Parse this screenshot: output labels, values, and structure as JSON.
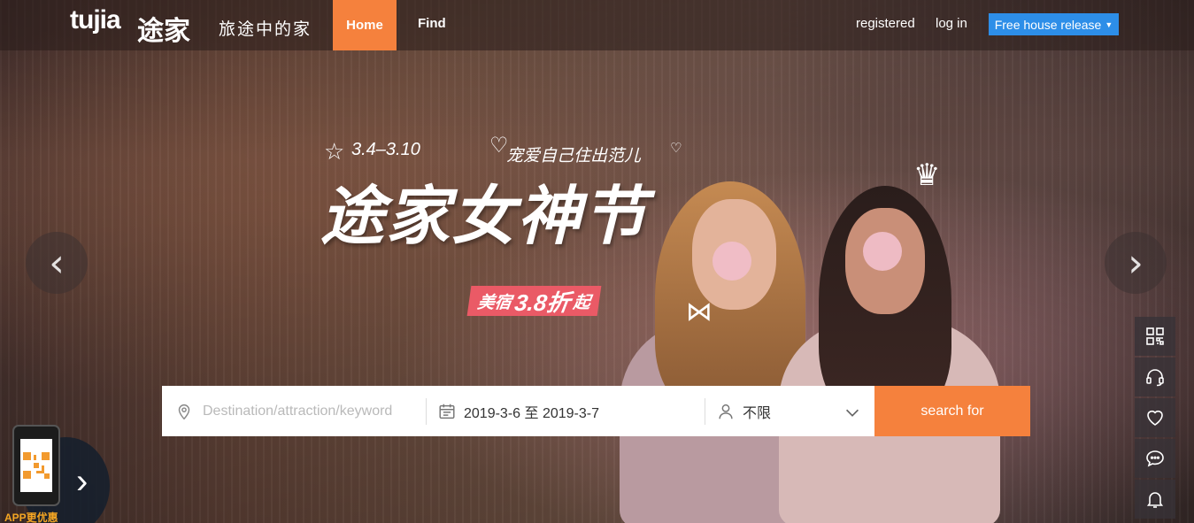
{
  "header": {
    "logo_text": "tujia",
    "logo_cn": "途家",
    "slogan": "旅途中的家",
    "nav": [
      {
        "label": "Home",
        "active": true
      },
      {
        "label": "Find",
        "active": false
      }
    ],
    "registered_label": "registered",
    "login_label": "log in",
    "release_label": "Free house release"
  },
  "promo": {
    "date_range": "3.4–3.10",
    "subtitle": "宠爱自己住出范儿",
    "title": "途家女神节",
    "badge_prefix": "美宿",
    "badge_discount": "3.8折",
    "badge_suffix": "起"
  },
  "search": {
    "destination_placeholder": "Destination/attraction/keyword",
    "dates": "2019-3-6 至 2019-3-7",
    "guests": "不限",
    "button_label": "search for"
  },
  "carousel": {
    "prev_glyph": "‹",
    "next_glyph": "›"
  },
  "app_promo": {
    "label": "APP更优惠",
    "next_glyph": "›"
  },
  "colors": {
    "accent_orange": "#f5813d",
    "release_blue": "#2d8ee8",
    "badge_pink": "#ea5a66"
  },
  "sidebar_icons": [
    "qr-code-icon",
    "headset-icon",
    "heart-icon",
    "chat-icon",
    "bell-icon"
  ]
}
